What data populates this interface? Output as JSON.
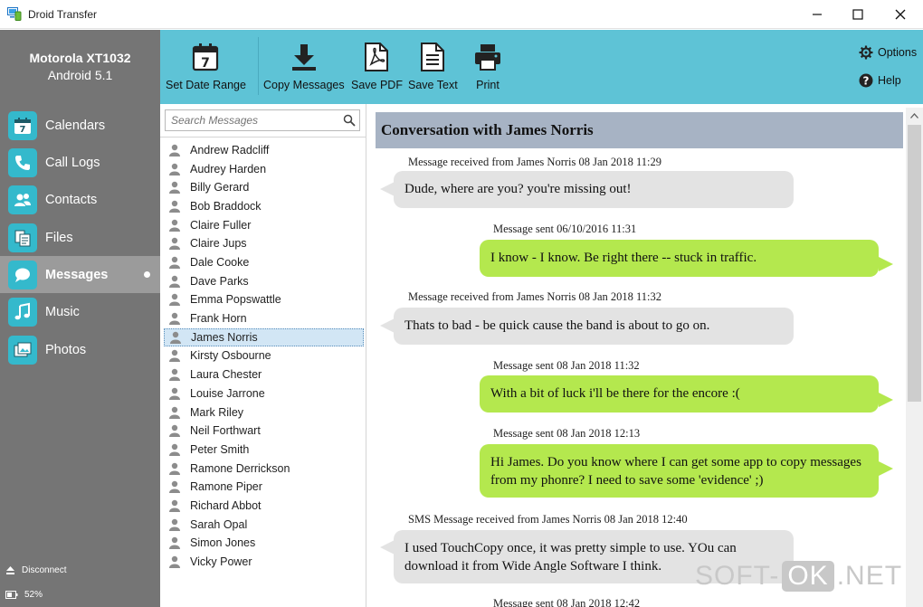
{
  "window": {
    "title": "Droid Transfer"
  },
  "device": {
    "model": "Motorola XT1032",
    "os": "Android 5.1"
  },
  "nav": [
    {
      "label": "Calendars",
      "icon": "calendar-icon",
      "active": false
    },
    {
      "label": "Call Logs",
      "icon": "phone-icon",
      "active": false
    },
    {
      "label": "Contacts",
      "icon": "contacts-icon",
      "active": false
    },
    {
      "label": "Files",
      "icon": "files-icon",
      "active": false
    },
    {
      "label": "Messages",
      "icon": "messages-icon",
      "active": true
    },
    {
      "label": "Music",
      "icon": "music-icon",
      "active": false
    },
    {
      "label": "Photos",
      "icon": "photos-icon",
      "active": false
    }
  ],
  "footer": {
    "disconnect": "Disconnect",
    "battery": "52%"
  },
  "toolbar": {
    "calendar_day": "7",
    "set_date_range": "Set Date Range",
    "copy_messages": "Copy Messages",
    "save_pdf": "Save PDF",
    "save_text": "Save Text",
    "print": "Print",
    "options": "Options",
    "help": "Help"
  },
  "search": {
    "placeholder": "Search Messages"
  },
  "contacts": [
    "Andrew Radcliff",
    "Audrey Harden",
    "Billy Gerard",
    "Bob Braddock",
    "Claire Fuller",
    "Claire Jups",
    "Dale Cooke",
    "Dave Parks",
    "Emma Popswattle",
    "Frank Horn",
    "James Norris",
    "Kirsty Osbourne",
    "Laura Chester",
    "Louise Jarrone",
    "Mark Riley",
    "Neil Forthwart",
    "Peter Smith",
    "Ramone Derrickson",
    "Ramone Piper",
    "Richard Abbot",
    "Sarah Opal",
    "Simon Jones",
    "Vicky Power"
  ],
  "selected_contact": "James Norris",
  "conversation": {
    "title": "Conversation with James Norris",
    "messages": [
      {
        "direction": "received",
        "meta": "Message received from James Norris 08 Jan 2018 11:29",
        "text": "Dude, where are you? you're missing out!"
      },
      {
        "direction": "sent",
        "meta": "Message sent 06/10/2016 11:31",
        "text": "I know - I know. Be right there -- stuck in traffic."
      },
      {
        "direction": "received",
        "meta": "Message received from James Norris 08 Jan 2018 11:32",
        "text": "Thats to bad - be quick cause the band is about to go on."
      },
      {
        "direction": "sent",
        "meta": "Message sent 08 Jan 2018 11:32",
        "text": "With a bit of luck i'll be there for the encore :("
      },
      {
        "direction": "sent",
        "meta": "Message sent 08 Jan 2018 12:13",
        "text": "Hi James. Do you know where I can get some app to copy messages from my phonre? I need to save some 'evidence' ;)"
      },
      {
        "direction": "received",
        "meta": "SMS Message received from James Norris 08 Jan 2018 12:40",
        "text": "I used TouchCopy once, it was pretty simple to use. YOu can download it from Wide Angle Software I think."
      },
      {
        "direction": "sent",
        "meta": "Message sent 08 Jan 2018 12:42",
        "text": ""
      }
    ]
  },
  "watermark": {
    "left": "SOFT-",
    "ok": "OK",
    "right": ".NET"
  },
  "colors": {
    "sidebar": "#757575",
    "sidebar_active": "#9b9b9b",
    "nav_icon_bg": "#34b9cc",
    "toolbar": "#5ec3d6",
    "header": "#a7b3c4",
    "bubble_received": "#e3e3e3",
    "bubble_sent": "#b4e84e"
  }
}
